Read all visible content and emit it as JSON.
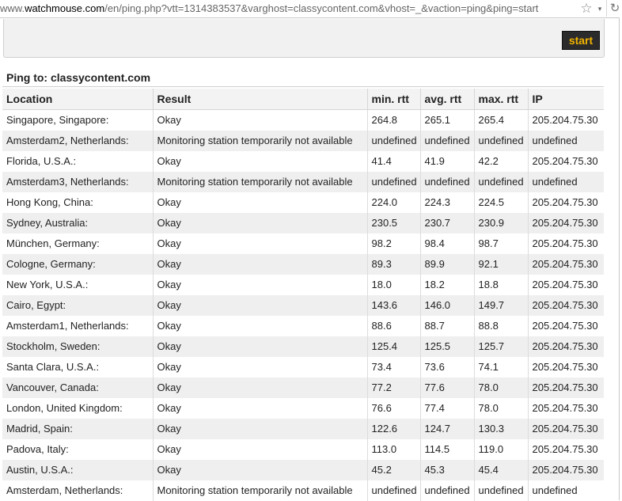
{
  "browser": {
    "url_prefix": "www.",
    "url_host": "watchmouse.com",
    "url_rest": "/en/ping.php?vtt=1314383537&varghost=classycontent.com&vhost=_&vaction=ping&ping=start",
    "star_icon": "☆",
    "dropdown_icon": "▾",
    "reload_icon": "↻"
  },
  "panel": {
    "start_label": "start"
  },
  "ping": {
    "title": "Ping to: classycontent.com",
    "columns": [
      "Location",
      "Result",
      "min. rtt",
      "avg. rtt",
      "max. rtt",
      "IP"
    ],
    "rows": [
      [
        "Singapore, Singapore:",
        "Okay",
        "264.8",
        "265.1",
        "265.4",
        "205.204.75.30"
      ],
      [
        "Amsterdam2, Netherlands:",
        "Monitoring station temporarily not available",
        "undefined",
        "undefined",
        "undefined",
        "undefined"
      ],
      [
        "Florida, U.S.A.:",
        "Okay",
        "41.4",
        "41.9",
        "42.2",
        "205.204.75.30"
      ],
      [
        "Amsterdam3, Netherlands:",
        "Monitoring station temporarily not available",
        "undefined",
        "undefined",
        "undefined",
        "undefined"
      ],
      [
        "Hong Kong, China:",
        "Okay",
        "224.0",
        "224.3",
        "224.5",
        "205.204.75.30"
      ],
      [
        "Sydney, Australia:",
        "Okay",
        "230.5",
        "230.7",
        "230.9",
        "205.204.75.30"
      ],
      [
        "München, Germany:",
        "Okay",
        "98.2",
        "98.4",
        "98.7",
        "205.204.75.30"
      ],
      [
        "Cologne, Germany:",
        "Okay",
        "89.3",
        "89.9",
        "92.1",
        "205.204.75.30"
      ],
      [
        "New York, U.S.A.:",
        "Okay",
        "18.0",
        "18.2",
        "18.8",
        "205.204.75.30"
      ],
      [
        "Cairo, Egypt:",
        "Okay",
        "143.6",
        "146.0",
        "149.7",
        "205.204.75.30"
      ],
      [
        "Amsterdam1, Netherlands:",
        "Okay",
        "88.6",
        "88.7",
        "88.8",
        "205.204.75.30"
      ],
      [
        "Stockholm, Sweden:",
        "Okay",
        "125.4",
        "125.5",
        "125.7",
        "205.204.75.30"
      ],
      [
        "Santa Clara, U.S.A.:",
        "Okay",
        "73.4",
        "73.6",
        "74.1",
        "205.204.75.30"
      ],
      [
        "Vancouver, Canada:",
        "Okay",
        "77.2",
        "77.6",
        "78.0",
        "205.204.75.30"
      ],
      [
        "London, United Kingdom:",
        "Okay",
        "76.6",
        "77.4",
        "78.0",
        "205.204.75.30"
      ],
      [
        "Madrid, Spain:",
        "Okay",
        "122.6",
        "124.7",
        "130.3",
        "205.204.75.30"
      ],
      [
        "Padova, Italy:",
        "Okay",
        "113.0",
        "114.5",
        "119.0",
        "205.204.75.30"
      ],
      [
        "Austin, U.S.A.:",
        "Okay",
        "45.2",
        "45.3",
        "45.4",
        "205.204.75.30"
      ],
      [
        "Amsterdam, Netherlands:",
        "Monitoring station temporarily not available",
        "undefined",
        "undefined",
        "undefined",
        "undefined"
      ]
    ]
  }
}
